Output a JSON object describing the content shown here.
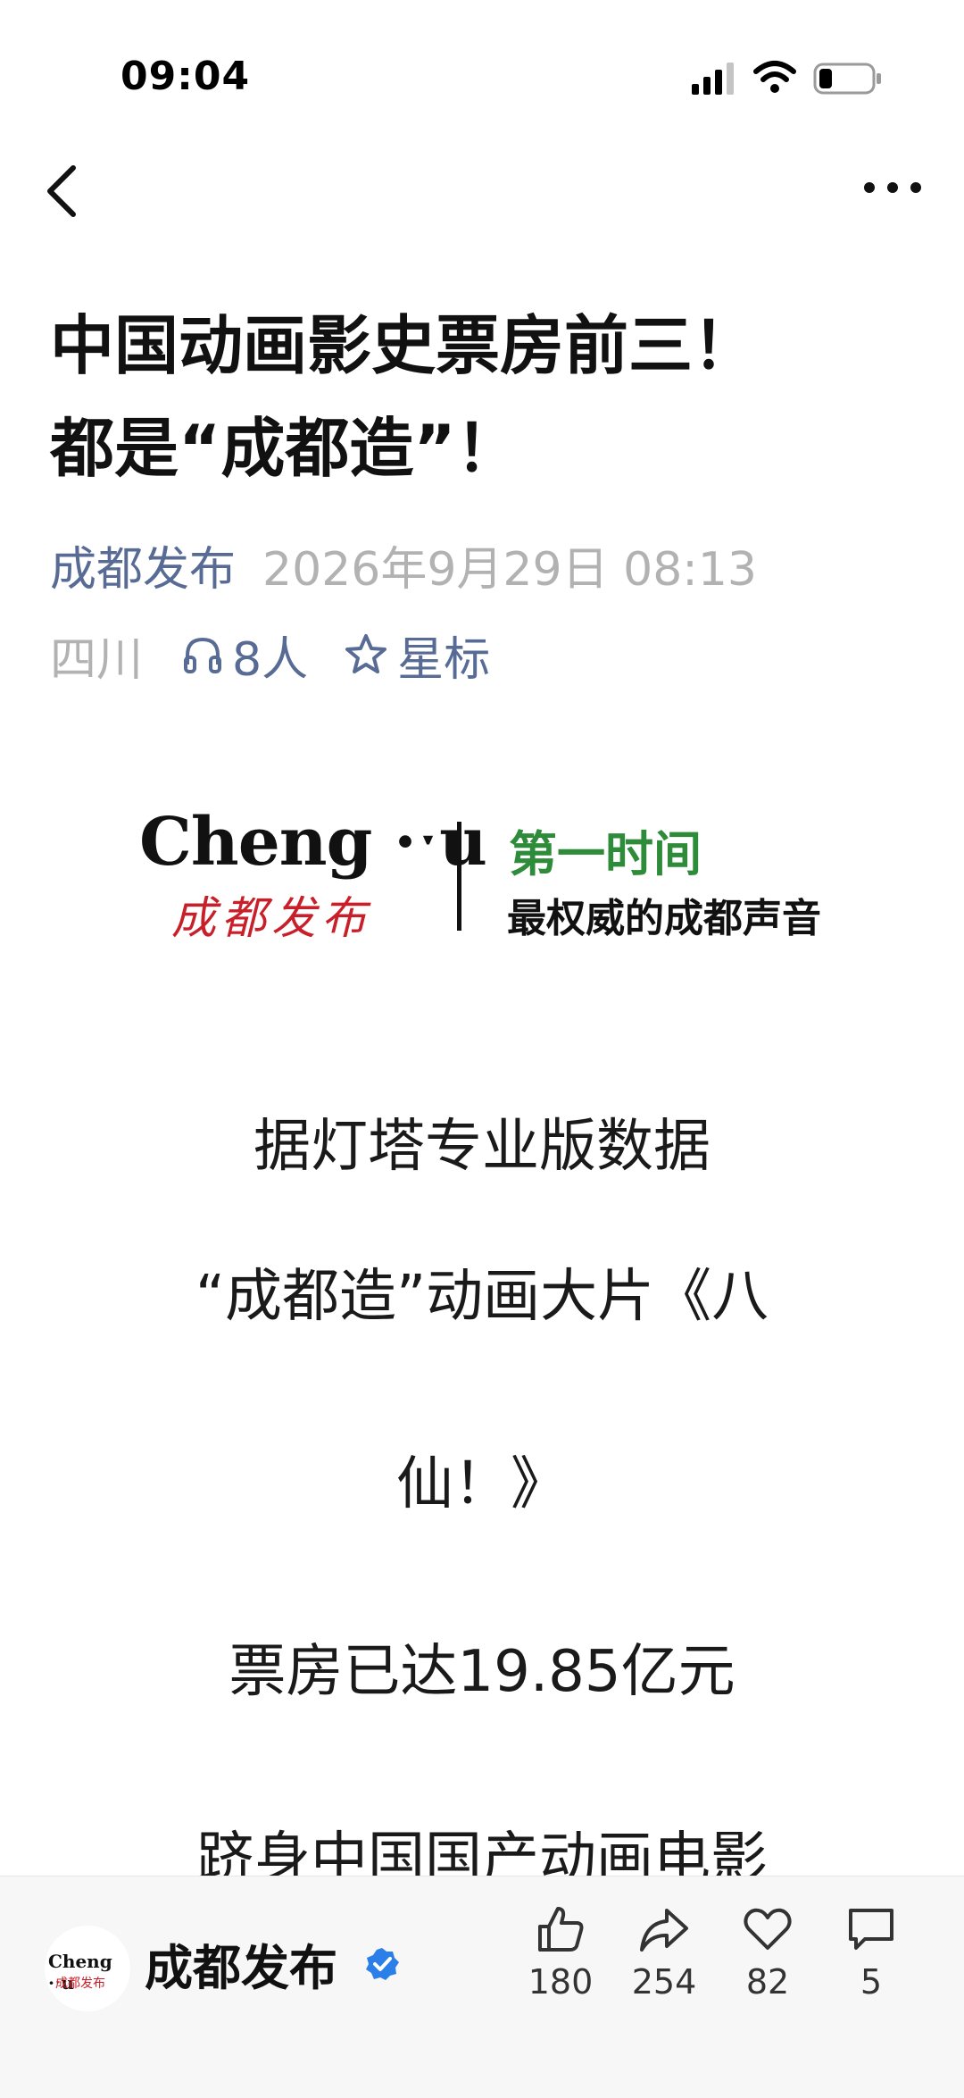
{
  "status_bar": {
    "time": "09:04"
  },
  "article": {
    "title_lines": [
      "中国动画影史票房前三！",
      "都是“成都造”！"
    ],
    "author": "成都发布",
    "publish_time": "2026年9月29日 08:13",
    "region": "四川",
    "listeners": "8人",
    "star_label": "星标"
  },
  "banner": {
    "logo_en": "Cheng ·ˑu",
    "logo_cn": "成都发布",
    "tagline_1": "第一时间",
    "tagline_2": "最权威的成都声音"
  },
  "body_paragraphs": [
    "据灯塔专业版数据",
    "“成都造”动画大片《八",
    "仙！》",
    "票房已达19.85亿元",
    "跻身中国国产动画电影"
  ],
  "bottom_bar": {
    "avatar_en": "Cheng ·ˑu",
    "avatar_cn": "成都发布",
    "account_name": "成都发布",
    "likes": "180",
    "shares": "254",
    "favorites": "82",
    "comments": "5"
  },
  "colors": {
    "link": "#576b95",
    "muted": "#b2b2b2",
    "brand_red": "#c8202a",
    "brand_green": "#2e8b3a",
    "verified_blue": "#2b7fe8"
  },
  "icons": [
    "signal-icon",
    "wifi-icon",
    "battery-icon",
    "back-arrow-icon",
    "more-dots-icon",
    "headphones-icon",
    "star-icon",
    "verified-icon",
    "thumbs-up-icon",
    "share-icon",
    "heart-icon",
    "comment-icon"
  ]
}
